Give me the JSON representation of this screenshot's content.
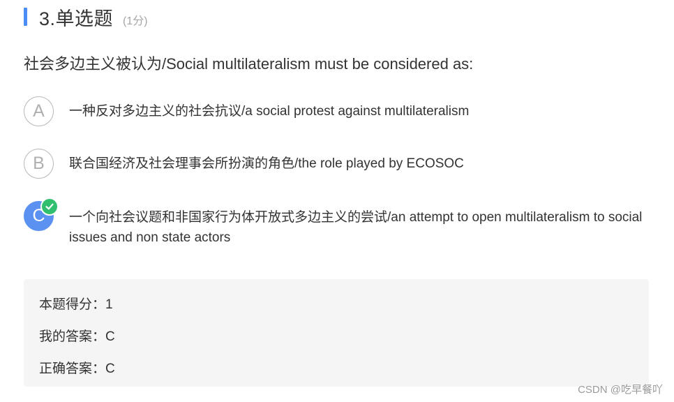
{
  "question": {
    "number_title": "3.单选题",
    "score": "(1分)",
    "stem": "社会多边主义被认为/Social multilateralism must be considered as:"
  },
  "options": [
    {
      "letter": "A",
      "text": "一种反对多边主义的社会抗议/a social protest against multilateralism",
      "selected": false
    },
    {
      "letter": "B",
      "text": "联合国经济及社会理事会所扮演的角色/the role played by ECOSOC",
      "selected": false
    },
    {
      "letter": "C",
      "text": "一个向社会议题和非国家行为体开放式多边主义的尝试/an attempt to open multilateralism to social issues and non state actors",
      "selected": true
    }
  ],
  "result": {
    "score_line": "本题得分：1",
    "my_answer_line": "我的答案：C",
    "correct_answer_line": "正确答案：C"
  },
  "watermark": "CSDN @吃早餐吖",
  "colors": {
    "accent": "#4a8ef5",
    "selected": "#5b92f2",
    "correct_check": "#2fbf6e",
    "result_bg": "#f5f5f5"
  },
  "icons": {
    "correct_badge": "check-icon"
  }
}
